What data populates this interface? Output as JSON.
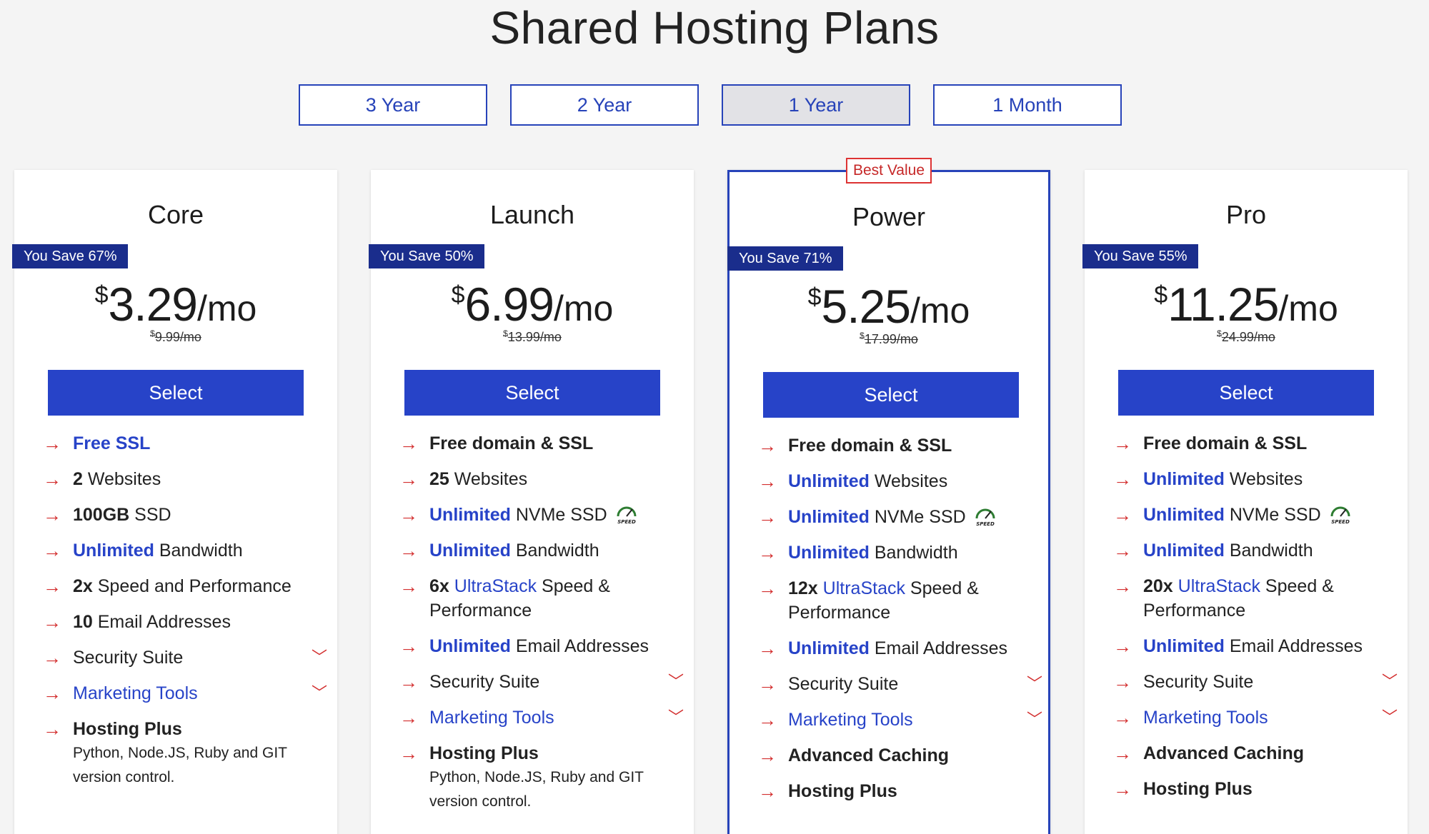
{
  "page_title": "Shared Hosting Plans",
  "term_tabs": [
    {
      "label": "3 Year",
      "active": false
    },
    {
      "label": "2 Year",
      "active": false
    },
    {
      "label": "1 Year",
      "active": true
    },
    {
      "label": "1 Month",
      "active": false
    }
  ],
  "colors": {
    "accent_blue": "#2743c8",
    "badge_navy": "#1a2d8c",
    "arrow_red": "#d32f2f",
    "speed_green": "#2e7d32"
  },
  "plans": [
    {
      "name": "Core",
      "save": "You Save 67%",
      "currency": "$",
      "price": "3.29",
      "per": "/mo",
      "old_price": "9.99/mo",
      "select": "Select",
      "features": [
        {
          "blue": "Free SSL"
        },
        {
          "bold": "2",
          "text": " Websites"
        },
        {
          "bold": "100GB",
          "text": " SSD"
        },
        {
          "blue": "Unlimited",
          "text": " Bandwidth"
        },
        {
          "bold": "2x",
          "text": " Speed and Performance"
        },
        {
          "bold": "10",
          "text": " Email Addresses"
        },
        {
          "text": "Security Suite",
          "chevron": true
        },
        {
          "link": "Marketing Tools",
          "chevron": true
        },
        {
          "bold": "Hosting Plus",
          "sub": "Python,  Node.JS,  Ruby and GIT version control."
        }
      ]
    },
    {
      "name": "Launch",
      "save": "You Save 50%",
      "currency": "$",
      "price": "6.99",
      "per": "/mo",
      "old_price": "13.99/mo",
      "select": "Select",
      "features": [
        {
          "bold": "Free domain & SSL"
        },
        {
          "bold": "25",
          "text": " Websites"
        },
        {
          "blue": "Unlimited",
          "text": " NVMe SSD",
          "speed": true
        },
        {
          "blue": "Unlimited",
          "text": " Bandwidth"
        },
        {
          "bold": "6x",
          "link": " UltraStack",
          "text": " Speed & Performance"
        },
        {
          "blue": "Unlimited",
          "text": " Email Addresses"
        },
        {
          "text": "Security Suite",
          "chevron": true
        },
        {
          "link": "Marketing Tools",
          "chevron": true
        },
        {
          "bold": "Hosting Plus",
          "sub": "Python,  Node.JS,  Ruby and GIT version control."
        }
      ]
    },
    {
      "name": "Power",
      "save": "You Save 71%",
      "currency": "$",
      "price": "5.25",
      "per": "/mo",
      "old_price": "17.99/mo",
      "select": "Select",
      "best_value": "Best Value",
      "features": [
        {
          "bold": "Free domain & SSL"
        },
        {
          "blue": "Unlimited",
          "text": " Websites"
        },
        {
          "blue": "Unlimited",
          "text": " NVMe SSD",
          "speed": true
        },
        {
          "blue": "Unlimited",
          "text": " Bandwidth"
        },
        {
          "bold": "12x",
          "link": " UltraStack",
          "text": " Speed & Performance"
        },
        {
          "blue": "Unlimited",
          "text": " Email Addresses"
        },
        {
          "text": "Security Suite",
          "chevron": true
        },
        {
          "link": "Marketing Tools",
          "chevron": true
        },
        {
          "bold": "Advanced Caching"
        },
        {
          "bold": "Hosting Plus"
        }
      ]
    },
    {
      "name": "Pro",
      "save": "You Save 55%",
      "currency": "$",
      "price": "11.25",
      "per": "/mo",
      "old_price": "24.99/mo",
      "select": "Select",
      "features": [
        {
          "bold": "Free domain & SSL"
        },
        {
          "blue": "Unlimited",
          "text": " Websites"
        },
        {
          "blue": "Unlimited",
          "text": " NVMe SSD",
          "speed": true
        },
        {
          "blue": "Unlimited",
          "text": " Bandwidth"
        },
        {
          "bold": "20x",
          "link": " UltraStack",
          "text": " Speed & Performance"
        },
        {
          "blue": "Unlimited",
          "text": " Email Addresses"
        },
        {
          "text": "Security Suite",
          "chevron": true
        },
        {
          "link": "Marketing Tools",
          "chevron": true
        },
        {
          "bold": "Advanced Caching"
        },
        {
          "bold": "Hosting Plus"
        }
      ]
    }
  ],
  "icons": {
    "feature_bullet": "arrow-right-icon",
    "expand": "chevron-down-icon",
    "speed": "speed-badge-icon"
  },
  "speed_label": "SPEED"
}
